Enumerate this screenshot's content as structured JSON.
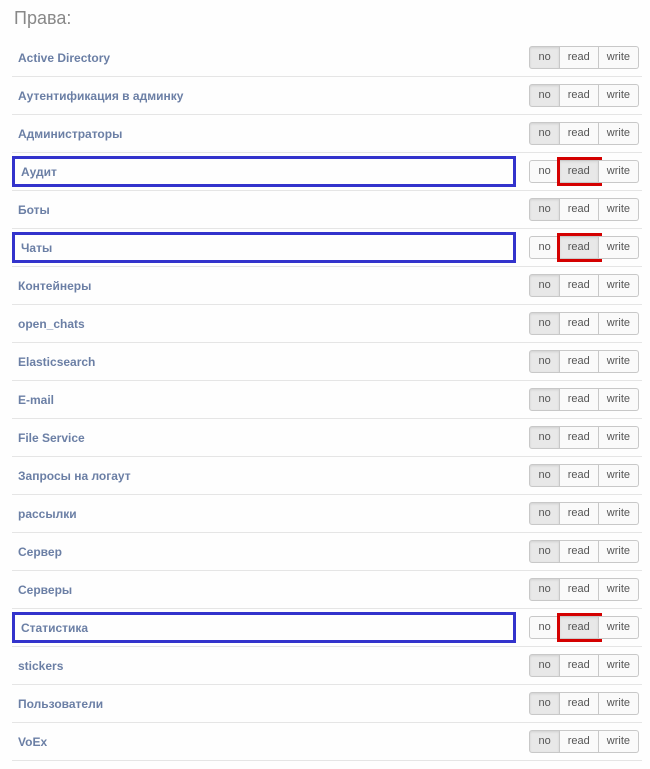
{
  "heading": "Права:",
  "buttons": {
    "no": "no",
    "read": "read",
    "write": "write"
  },
  "permissions": [
    {
      "label": "Active Directory",
      "selected": "no",
      "highlight": false,
      "read_highlight": false
    },
    {
      "label": "Аутентификация в админку",
      "selected": "no",
      "highlight": false,
      "read_highlight": false
    },
    {
      "label": "Администраторы",
      "selected": "no",
      "highlight": false,
      "read_highlight": false
    },
    {
      "label": "Аудит",
      "selected": "read",
      "highlight": true,
      "read_highlight": true
    },
    {
      "label": "Боты",
      "selected": "no",
      "highlight": false,
      "read_highlight": false
    },
    {
      "label": "Чаты",
      "selected": "read",
      "highlight": true,
      "read_highlight": true
    },
    {
      "label": "Контейнеры",
      "selected": "no",
      "highlight": false,
      "read_highlight": false
    },
    {
      "label": "open_chats",
      "selected": "no",
      "highlight": false,
      "read_highlight": false
    },
    {
      "label": "Elasticsearch",
      "selected": "no",
      "highlight": false,
      "read_highlight": false
    },
    {
      "label": "E-mail",
      "selected": "no",
      "highlight": false,
      "read_highlight": false
    },
    {
      "label": "File Service",
      "selected": "no",
      "highlight": false,
      "read_highlight": false
    },
    {
      "label": "Запросы на логаут",
      "selected": "no",
      "highlight": false,
      "read_highlight": false
    },
    {
      "label": "рассылки",
      "selected": "no",
      "highlight": false,
      "read_highlight": false
    },
    {
      "label": "Сервер",
      "selected": "no",
      "highlight": false,
      "read_highlight": false
    },
    {
      "label": "Серверы",
      "selected": "no",
      "highlight": false,
      "read_highlight": false
    },
    {
      "label": "Статистика",
      "selected": "read",
      "highlight": true,
      "read_highlight": true
    },
    {
      "label": "stickers",
      "selected": "no",
      "highlight": false,
      "read_highlight": false
    },
    {
      "label": "Пользователи",
      "selected": "no",
      "highlight": false,
      "read_highlight": false
    },
    {
      "label": "VoEx",
      "selected": "no",
      "highlight": false,
      "read_highlight": false
    }
  ]
}
